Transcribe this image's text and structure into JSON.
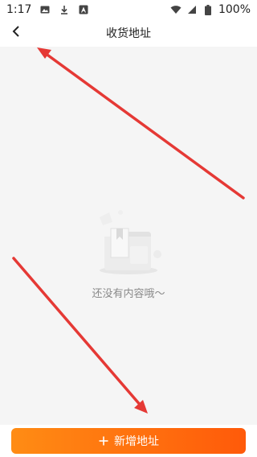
{
  "status_bar": {
    "time": "1:17",
    "battery": "100%",
    "left_icons": [
      "image-icon",
      "download-icon",
      "font-icon"
    ],
    "right_icons": [
      "wifi-icon",
      "signal-icon",
      "battery-icon"
    ]
  },
  "header": {
    "title": "收货地址",
    "back_icon": "chevron-left-icon"
  },
  "empty_state": {
    "message": "还没有内容哦～",
    "illustration": "empty-folder-illustration"
  },
  "footer": {
    "add_button_label": "新增地址",
    "add_icon": "plus-icon"
  },
  "colors": {
    "primary_start": "#ff8c14",
    "primary_end": "#ff5a0a",
    "annotation_arrow": "#e53935",
    "background": "#f5f5f5"
  }
}
